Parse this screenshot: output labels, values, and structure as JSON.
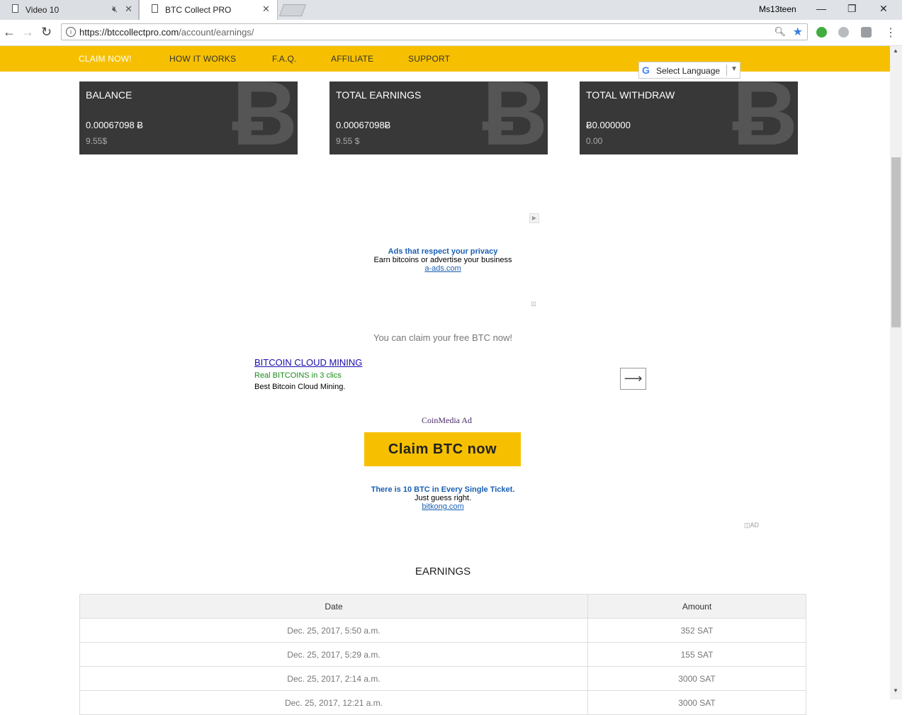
{
  "browser": {
    "tabs": [
      {
        "title": "Video 10"
      },
      {
        "title": "BTC Collect PRO"
      }
    ],
    "profile_name": "Ms13teen",
    "url_host": "https://btccollectpro.com",
    "url_path": "/account/earnings/"
  },
  "nav": {
    "items": [
      "CLAIM NOW!",
      "HOW IT WORKS",
      "F.A.Q.",
      "AFFILIATE",
      "SUPPORT"
    ],
    "active_color": "#ffffff",
    "bar_color": "#f6c000"
  },
  "translate": {
    "label": "Select Language"
  },
  "cards": [
    {
      "title": "BALANCE",
      "value": "0.00067098 Ƀ",
      "usd": "9.55$"
    },
    {
      "title": "TOTAL EARNINGS",
      "value": "0.00067098Ƀ",
      "usd": "9.55 $"
    },
    {
      "title": "TOTAL WITHDRAW",
      "value": "Ƀ0.000000",
      "usd": "0.00"
    }
  ],
  "ad1": {
    "headline": "Ads that respect your privacy",
    "text": "Earn bitcoins or advertise your business",
    "link": "a-ads.com"
  },
  "claim_text": "You can claim your free BTC now!",
  "ad2": {
    "link": "BITCOIN CLOUD MINING",
    "tagline": "Real BITCOINS in 3 clics",
    "desc": "Best Bitcoin Cloud Mining."
  },
  "coinmedia": "CoinMedia Ad",
  "claim_button": "Claim BTC now",
  "ad3": {
    "headline": "There is 10 BTC in Every Single Ticket.",
    "text": "Just guess right.",
    "link": "bitkong.com"
  },
  "ad_label": "AD",
  "earnings": {
    "title": "EARNINGS",
    "columns": [
      "Date",
      "Amount"
    ],
    "rows": [
      {
        "date": "Dec. 25, 2017, 5:50 a.m.",
        "amount": "352 SAT"
      },
      {
        "date": "Dec. 25, 2017, 5:29 a.m.",
        "amount": "155 SAT"
      },
      {
        "date": "Dec. 25, 2017, 2:14 a.m.",
        "amount": "3000 SAT"
      },
      {
        "date": "Dec. 25, 2017, 12:21 a.m.",
        "amount": "3000 SAT"
      }
    ]
  }
}
